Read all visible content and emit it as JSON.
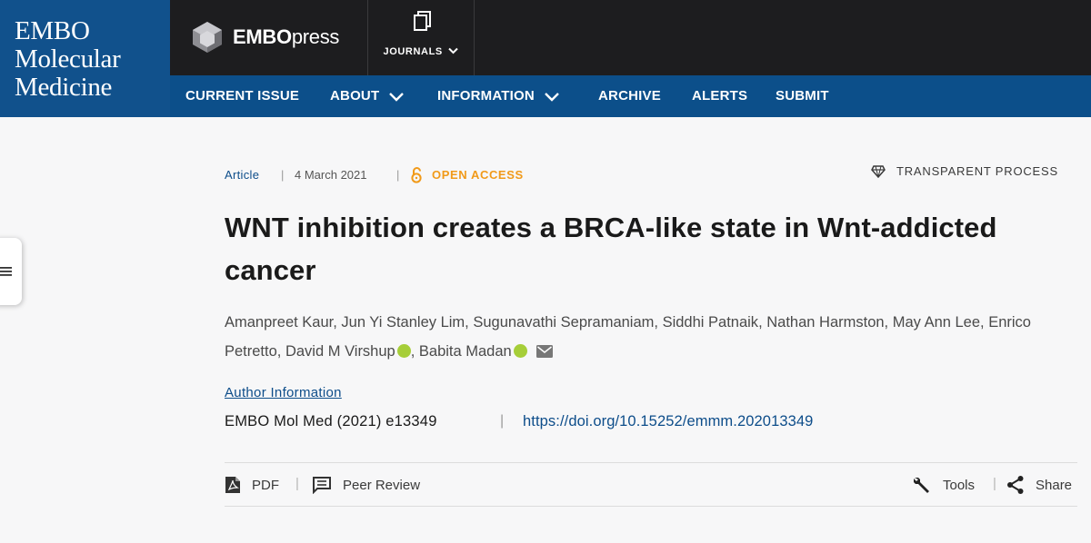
{
  "brand": {
    "journal_name_lines": [
      "EMBO",
      "Molecular",
      "Medicine"
    ],
    "publisher_bold": "EMBO",
    "publisher_light": "press",
    "journals_label": "JOURNALS"
  },
  "nav": {
    "items": [
      {
        "label": "CURRENT ISSUE",
        "has_dropdown": false
      },
      {
        "label": "ABOUT",
        "has_dropdown": true
      },
      {
        "label": "INFORMATION",
        "has_dropdown": true
      },
      {
        "label": "ARCHIVE",
        "has_dropdown": false
      },
      {
        "label": "ALERTS",
        "has_dropdown": false
      },
      {
        "label": "SUBMIT",
        "has_dropdown": false
      }
    ]
  },
  "article": {
    "type": "Article",
    "date": "4 March 2021",
    "access": "OPEN ACCESS",
    "process": "TRANSPARENT PROCESS",
    "title": "WNT inhibition creates a BRCA-like state in Wnt-addicted cancer",
    "authors": [
      "Amanpreet Kaur",
      "Jun Yi Stanley Lim",
      "Sugunavathi Sepramaniam",
      "Siddhi Patnaik",
      "Nathan Harmston",
      "May Ann Lee",
      "Enrico Petretto",
      "David M Virshup",
      "Babita Madan"
    ],
    "author_info_link": "Author Information",
    "citation": "EMBO Mol Med (2021) e13349",
    "separator": "|",
    "doi": "https://doi.org/10.15252/emmm.202013349"
  },
  "toolbar": {
    "pdf": "PDF",
    "peer_review": "Peer Review",
    "tools": "Tools",
    "share": "Share"
  },
  "colors": {
    "header_bg": "#1d1d1f",
    "nav_bg": "#0c4f8a",
    "brand_bg": "#11518c",
    "link_blue": "#0d4d8a",
    "open_access_orange": "#f19a19",
    "orcid_green": "#a6ce39"
  }
}
